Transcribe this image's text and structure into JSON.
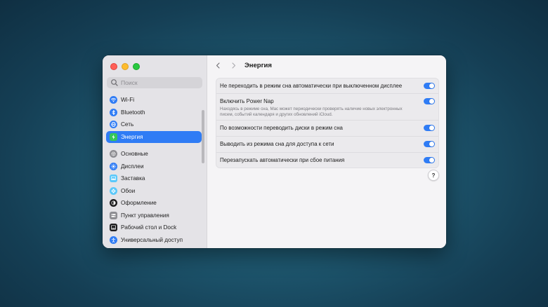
{
  "window": {
    "title": "Энергия",
    "search": {
      "placeholder": "Поиск"
    }
  },
  "sidebar": {
    "items": [
      {
        "label": "Wi-Fi",
        "icon": "wifi-icon",
        "color": "#2f7cf5",
        "selected": false
      },
      {
        "label": "Bluetooth",
        "icon": "bluetooth-icon",
        "color": "#2f7cf5",
        "selected": false
      },
      {
        "label": "Сеть",
        "icon": "globe-icon",
        "color": "#2f7cf5",
        "selected": false
      },
      {
        "label": "Энергия",
        "icon": "battery-bolt-icon",
        "color": "#34c759",
        "selected": true
      },
      {
        "label": "Основные",
        "icon": "gear-icon",
        "color": "#8e8e93",
        "selected": false
      },
      {
        "label": "Дисплеи",
        "icon": "brightness-icon",
        "color": "#2f7cf5",
        "selected": false
      },
      {
        "label": "Заставка",
        "icon": "screensaver-icon",
        "color": "#5ac8fa",
        "selected": false
      },
      {
        "label": "Обои",
        "icon": "flower-icon",
        "color": "#5ac8fa",
        "selected": false
      },
      {
        "label": "Оформление",
        "icon": "appearance-icon",
        "color": "#1c1c1e",
        "selected": false
      },
      {
        "label": "Пункт управления",
        "icon": "control-center-icon",
        "color": "#8e8e93",
        "selected": false
      },
      {
        "label": "Рабочий стол и Dock",
        "icon": "dock-icon",
        "color": "#1c1c1e",
        "selected": false
      },
      {
        "label": "Универсальный доступ",
        "icon": "accessibility-icon",
        "color": "#2f7cf5",
        "selected": false
      }
    ]
  },
  "settings": [
    {
      "label": "Не переходить в режим сна автоматически при выключенном дисплее",
      "description": "",
      "enabled": true
    },
    {
      "label": "Включить Power Nap",
      "description": "Находясь в режиме сна, Mac может периодически проверять наличие новых электронных писем, событий календаря и других обновлений iCloud.",
      "enabled": true
    },
    {
      "label": "По возможности переводить диски в режим сна",
      "description": "",
      "enabled": true
    },
    {
      "label": "Выводить из режима сна для доступа к сети",
      "description": "",
      "enabled": true
    },
    {
      "label": "Перезапускать автоматически при сбое питания",
      "description": "",
      "enabled": true
    }
  ],
  "help": {
    "label": "?"
  },
  "colors": {
    "accent": "#2f7cf5",
    "sidebar_bg": "#e4e3e7",
    "content_bg": "#f5f4f6"
  }
}
